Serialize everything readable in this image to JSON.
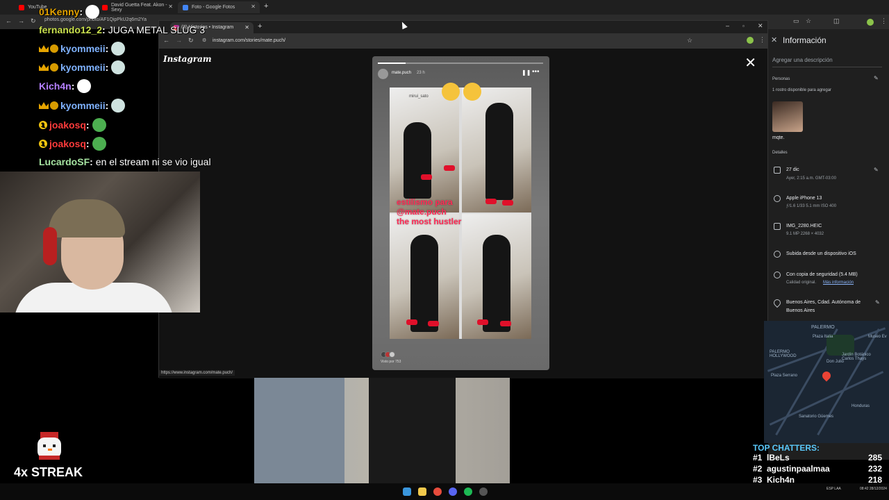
{
  "outer_browser": {
    "tabs": [
      {
        "title": "YouTube",
        "color": "#ff0000"
      },
      {
        "title": "David Guetta Feat. Akon - Sexy",
        "color": "#ff0000"
      },
      {
        "title": "Foto - Google Fotos",
        "color": "#4285f4"
      }
    ],
    "url": "photos.google.com/photo/AF1QipPkU2q6m2Ya"
  },
  "chat": {
    "messages": [
      {
        "user": "01Kenny",
        "text": "",
        "color": "#e5a400",
        "emote": "#ffffff"
      },
      {
        "user": "fernando12_2",
        "text": "JUGA METAL SLUG 3",
        "color": "#c9e04e",
        "emote": ""
      },
      {
        "user": "kyommeii",
        "text": "",
        "color": "#7fb2ff",
        "emote": "#cfe3e0"
      },
      {
        "user": "kyommeii",
        "text": "",
        "color": "#7fb2ff",
        "emote": "#cfe3e0"
      },
      {
        "user": "Kich4n",
        "text": "",
        "color": "#b580ff",
        "emote": "#ffffff"
      },
      {
        "user": "kyommeii",
        "text": "",
        "color": "#7fb2ff",
        "emote": "#cfe3e0"
      },
      {
        "user": "joakosq",
        "text": "",
        "color": "#ff3b3b",
        "emote": "#4caf50"
      },
      {
        "user": "joakosq",
        "text": "",
        "color": "#ff3b3b",
        "emote": "#4caf50"
      },
      {
        "user": "LucardoSF",
        "text": "en el stream ni se vio igual",
        "color": "#a6e3a1",
        "emote": ""
      }
    ]
  },
  "inner_browser": {
    "tab_title": "(3) Historias • Instagram",
    "url": "instagram.com/stories/mate.puch/",
    "status_url": "https://www.instagram.com/mate.puch/"
  },
  "instagram": {
    "logo": "Instagram",
    "story": {
      "username": "mate.puch",
      "time": "23 h",
      "progress": 0.17,
      "caption": [
        "estilismo para",
        "@mate.puch",
        "the most hustler"
      ],
      "photo_label": "mirui_sato",
      "viewed_by": "Visto por 753"
    }
  },
  "info_panel": {
    "title": "Información",
    "description_placeholder": "Agregar una descripción",
    "people_header": "Personas",
    "people_note": "1 rostro disponible para agregar",
    "person_name": "mqte.",
    "details_header": "Detalles",
    "date": "27 dic",
    "date_sub": "Ayer, 2:15 a.m.   GMT-03:00",
    "camera": "Apple iPhone 13",
    "camera_sub": "ƒ/1.6   1/33   5.1 mm   ISO 400",
    "file": "IMG_2280.HEIC",
    "file_sub": "9.1 MP   2268 × 4032",
    "upload": "Subida desde un dispositivo iOS",
    "backup": "Con copia de seguridad (5.4 MB)",
    "backup_sub": "Calidad original.",
    "backup_link": "Más información",
    "location_line1": "Buenos Aires, Cdad. Autónoma de",
    "location_line2": "Buenos Aires",
    "map_labels": [
      "PALERMO",
      "Plaza Italia",
      "PALERMO HOLLYWOOD",
      "Jardín Botánico Carlos Thays",
      "Don Julio",
      "Museo Ev",
      "Plaza Serrano",
      "Honduras",
      "Sanatorio Güemes"
    ]
  },
  "streak": {
    "text": "4x STREAK"
  },
  "top_chatters": {
    "title": "TOP CHATTERS:",
    "rows": [
      {
        "rank": "#1",
        "name": "lBeLs",
        "count": "285"
      },
      {
        "rank": "#2",
        "name": "agustinpaalmaa",
        "count": "232"
      },
      {
        "rank": "#3",
        "name": "Kich4n",
        "count": "218"
      }
    ]
  },
  "taskbar": {
    "lang": "ESP LAA",
    "clock": "08:42 28/12/2024"
  }
}
